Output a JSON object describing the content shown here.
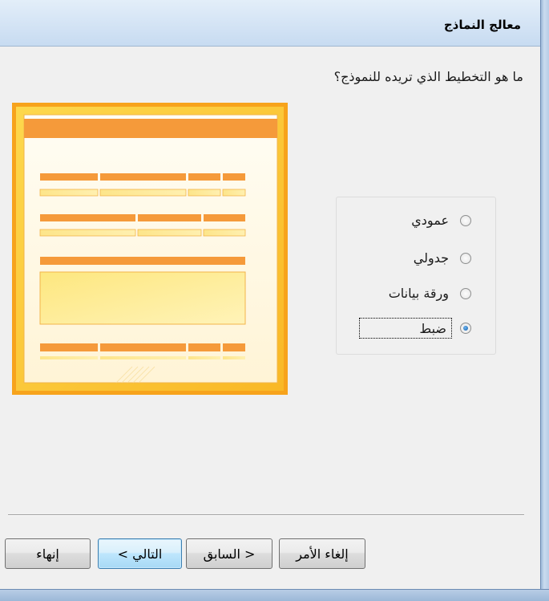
{
  "window": {
    "title": "معالج النماذج"
  },
  "question": "ما هو التخطيط الذي تريده للنموذج؟",
  "layout_options": [
    {
      "label": "عمودي",
      "selected": false
    },
    {
      "label": "جدولي",
      "selected": false
    },
    {
      "label": "ورقة بيانات",
      "selected": false
    },
    {
      "label": "ضبط",
      "selected": true
    }
  ],
  "buttons": {
    "cancel": "إلغاء الأمر",
    "back": "< السابق",
    "next": "التالي >",
    "finish": "إنهاء"
  },
  "colors": {
    "preview_outer": "#f7a31c",
    "preview_frame": "#fdd23f",
    "preview_bar": "#f59a3a",
    "preview_field": "#fde27a",
    "title_gradient_top": "#e3eef9",
    "title_gradient_bottom": "#c7dbf1",
    "default_button": "#bee6fd"
  },
  "icons": {
    "preview": "form-layout-preview-icon",
    "radio": "radio-button-icon"
  }
}
